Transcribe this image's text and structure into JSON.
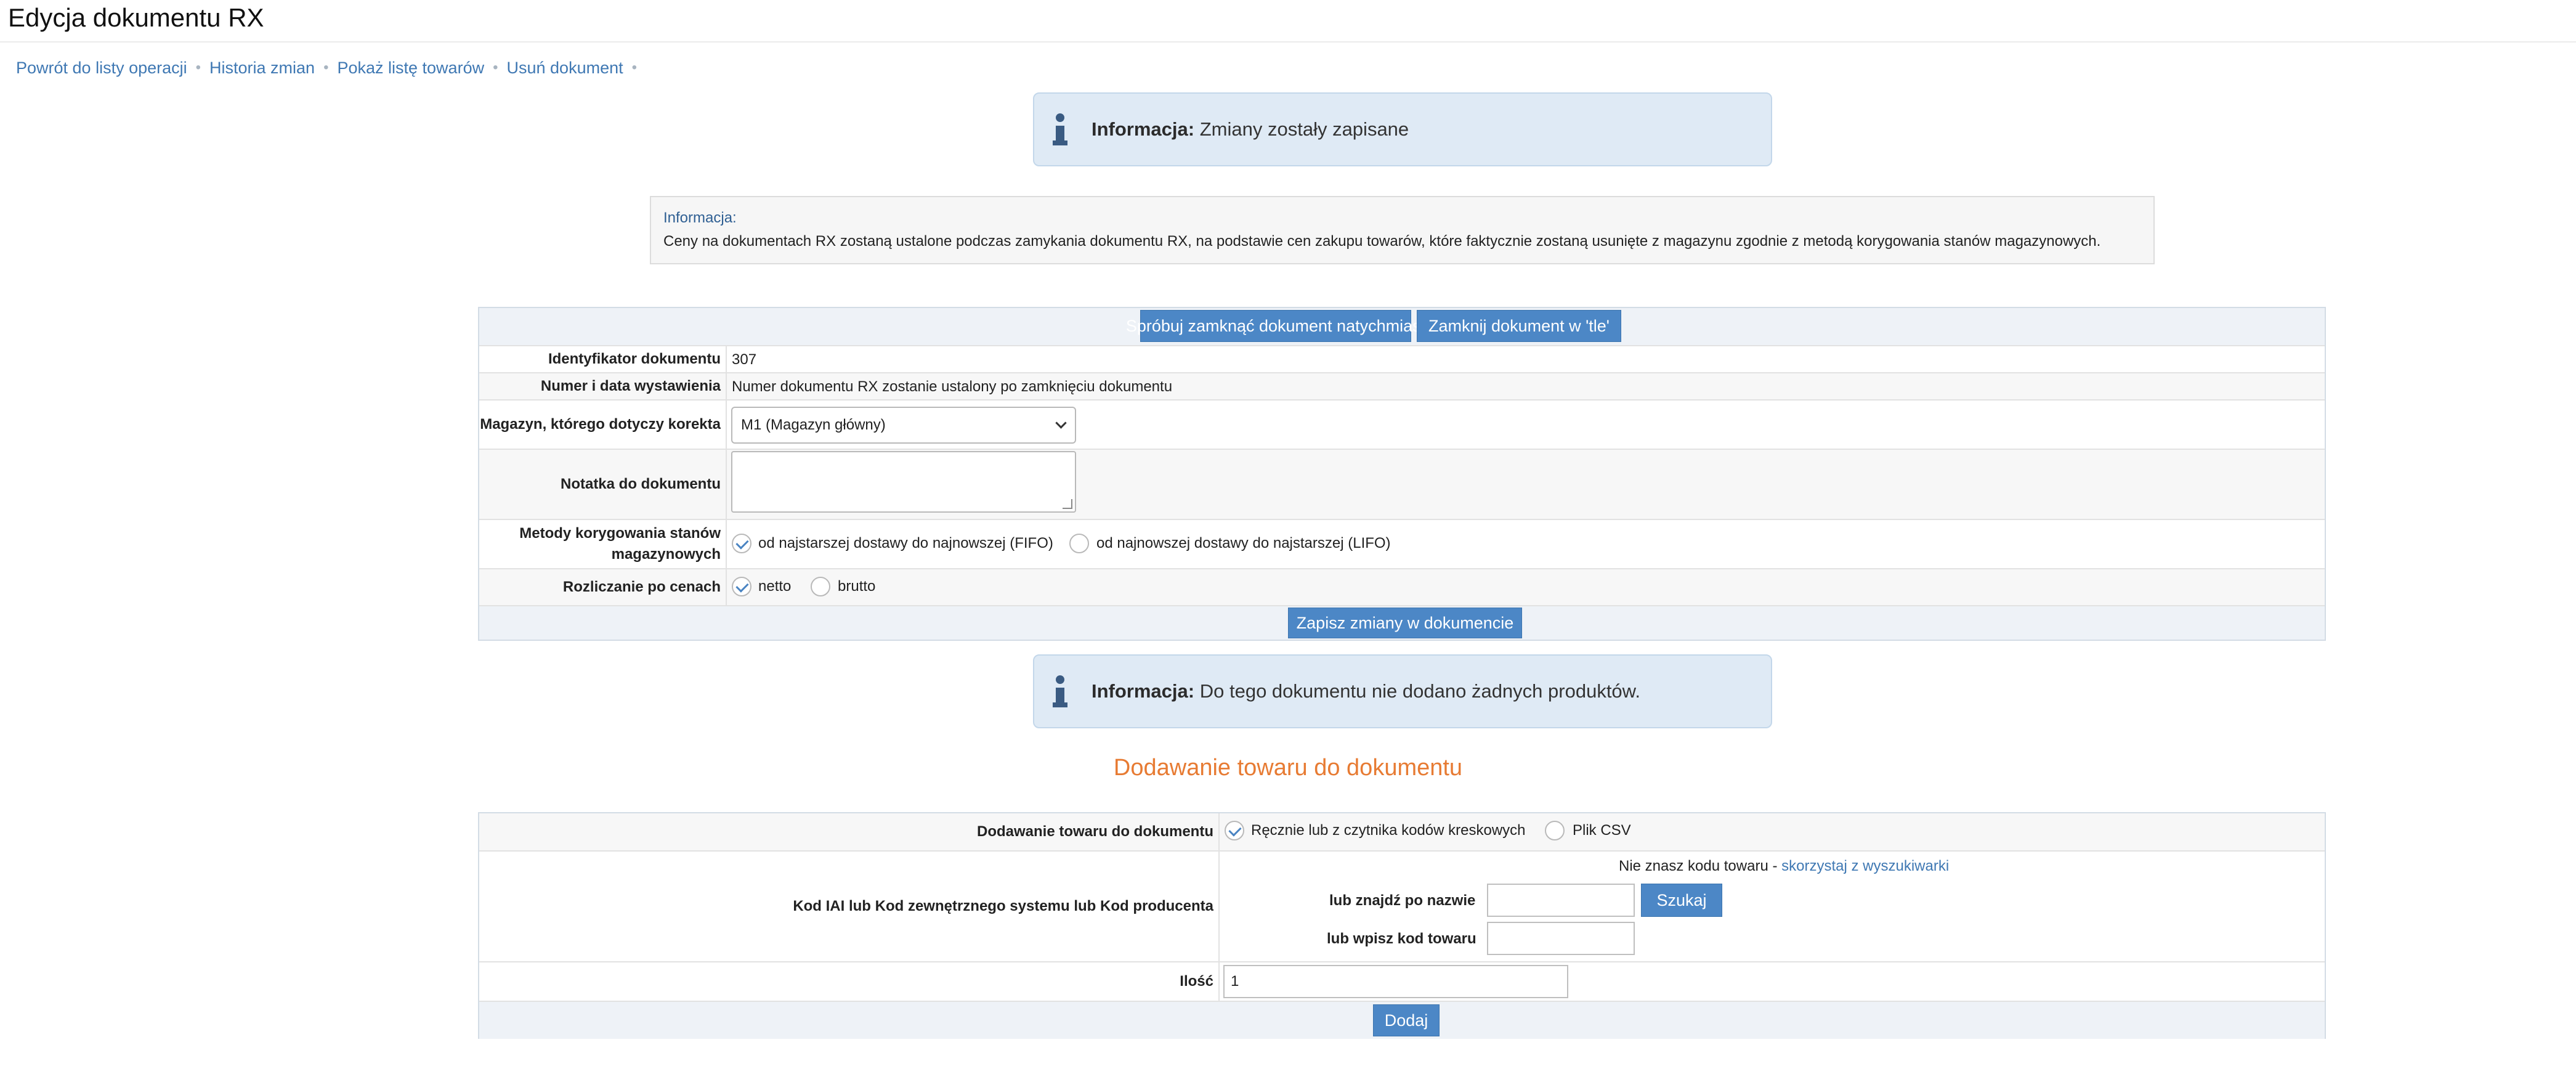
{
  "page": {
    "title": "Edycja dokumentu RX"
  },
  "breadcrumbs": [
    {
      "label": "Powrót do listy operacji"
    },
    {
      "label": "Historia zmian"
    },
    {
      "label": "Pokaż listę towarów"
    },
    {
      "label": "Usuń dokument"
    }
  ],
  "info_saved": {
    "label": "Informacja:",
    "text": "Zmiany zostały zapisane"
  },
  "notice": {
    "label": "Informacja:",
    "text": "Ceny na dokumentach RX zostaną ustalone podczas zamykania dokumentu RX, na podstawie cen zakupu towarów, które faktycznie zostaną usunięte z magazynu zgodnie z metodą korygowania stanów magazynowych."
  },
  "doc_form": {
    "close_now_button": "Spróbuj zamknąć dokument natychmiast",
    "close_background_button": "Zamknij dokument w 'tle'",
    "id_label": "Identyfikator dokumentu",
    "id_value": "307",
    "number_label": "Numer i data wystawienia",
    "number_value": "Numer dokumentu RX zostanie ustalony po zamknięciu dokumentu",
    "warehouse_label": "Magazyn, którego dotyczy korekta",
    "warehouse_value": "M1 (Magazyn główny)",
    "note_label": "Notatka do dokumentu",
    "note_value": "",
    "method_label": "Metody korygowania stanów magazynowych",
    "method_options": [
      {
        "label": "od najstarszej dostawy do najnowszej (FIFO)",
        "checked": true
      },
      {
        "label": "od najnowszej dostawy do najstarszej (LIFO)",
        "checked": false
      }
    ],
    "pricing_label": "Rozliczanie po cenach",
    "pricing_options": [
      {
        "label": "netto",
        "checked": true
      },
      {
        "label": "brutto",
        "checked": false
      }
    ],
    "save_button": "Zapisz zmiany w dokumencie"
  },
  "info_empty": {
    "label": "Informacja:",
    "text": "Do tego dokumentu nie dodano żadnych produktów."
  },
  "add_section": {
    "title": "Dodawanie towaru do dokumentu",
    "mode_label": "Dodawanie towaru do dokumentu",
    "mode_options": [
      {
        "label": "Ręcznie lub z czytnika kodów kreskowych",
        "checked": true
      },
      {
        "label": "Plik CSV",
        "checked": false
      }
    ],
    "code_label": "Kod IAI lub Kod zewnętrznego systemu lub Kod producenta",
    "hint_text": "Nie znasz kodu towaru - ",
    "hint_link": "skorzystaj z wyszukiwarki",
    "name_label": "lub znajdź po nazwie",
    "name_value": "",
    "search_button": "Szukaj",
    "code_entry_label": "lub wpisz kod towaru",
    "code_entry_value": "",
    "qty_label": "Ilość",
    "qty_value": "1",
    "add_button": "Dodaj"
  },
  "colors": {
    "accent": "#4c87c6",
    "link": "#3f78b3",
    "section_title": "#e77b33",
    "info_bg": "#dfeaf5"
  }
}
